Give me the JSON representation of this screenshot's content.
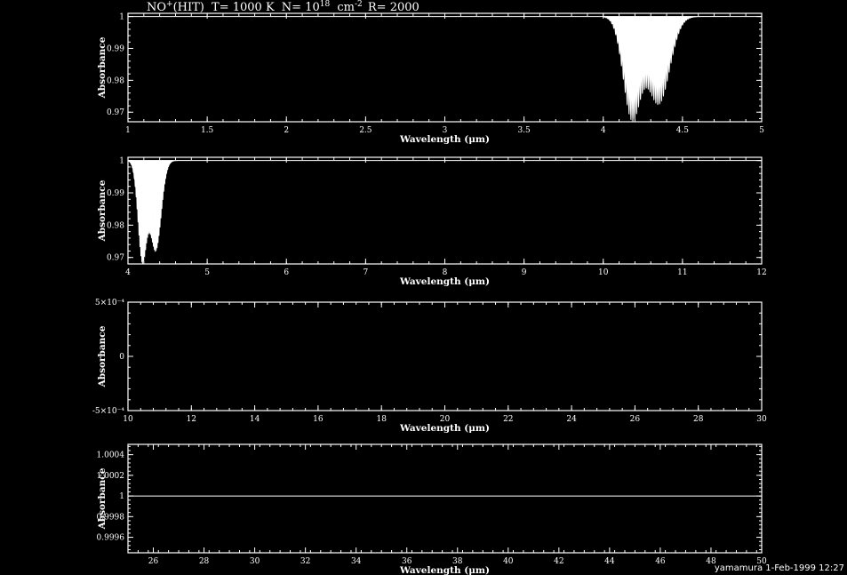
{
  "title": {
    "species": "NO",
    "species_sup": "+",
    "source": "(HIT)",
    "temperature": "T= 1000 K",
    "column_prefix": "N= 10",
    "column_exp": "18",
    "column_unit": "cm",
    "column_unit_exp": "-2",
    "resolution": "R= 2000"
  },
  "footer": "yamamura  1-Feb-1999 12:27",
  "chart_data": [
    {
      "type": "area",
      "xlabel": "Wavelength (μm)",
      "ylabel": "Absorbance",
      "xlim": [
        1,
        5
      ],
      "ylim": [
        0.967,
        1.001
      ],
      "xticks": [
        1,
        1.5,
        2,
        2.5,
        3,
        3.5,
        4,
        4.5,
        5
      ],
      "xticklabels": [
        "1",
        "1.5",
        "2",
        "2.5",
        "3",
        "3.5",
        "4",
        "4.5",
        "5"
      ],
      "yticks": [
        0.97,
        0.98,
        0.99,
        1
      ],
      "yticklabels": [
        "0.97",
        "0.98",
        "0.99",
        "1"
      ],
      "bands": [
        {
          "center": 4.18,
          "depth": 0.0315,
          "width": 0.055
        },
        {
          "center": 4.35,
          "depth": 0.0275,
          "width": 0.07
        }
      ],
      "band_range": [
        4.0,
        4.78
      ]
    },
    {
      "type": "area",
      "xlabel": "Wavelength (μm)",
      "ylabel": "Absorbance",
      "xlim": [
        4,
        12
      ],
      "ylim": [
        0.968,
        1.001
      ],
      "xticks": [
        4,
        5,
        6,
        7,
        8,
        9,
        10,
        11,
        12
      ],
      "xticklabels": [
        "4",
        "5",
        "6",
        "7",
        "8",
        "9",
        "10",
        "11",
        "12"
      ],
      "yticks": [
        0.97,
        0.98,
        0.99,
        1
      ],
      "yticklabels": [
        "0.97",
        "0.98",
        "0.99",
        "1"
      ],
      "bands": [
        {
          "center": 4.18,
          "depth": 0.0305,
          "width": 0.055
        },
        {
          "center": 4.35,
          "depth": 0.028,
          "width": 0.07
        }
      ],
      "band_range": [
        4.0,
        4.78
      ]
    },
    {
      "type": "line",
      "xlabel": "Wavelength (μm)",
      "ylabel": "Absorbance",
      "xlim": [
        10,
        30
      ],
      "ylim": [
        -0.0005,
        0.0005
      ],
      "xticks": [
        10,
        12,
        14,
        16,
        18,
        20,
        22,
        24,
        26,
        28,
        30
      ],
      "xticklabels": [
        "10",
        "12",
        "14",
        "16",
        "18",
        "20",
        "22",
        "24",
        "26",
        "28",
        "30"
      ],
      "yticks": [
        -0.0005,
        0,
        0.0005
      ],
      "yticklabels": [
        "-5×10⁻⁴",
        "0",
        "5×10⁻⁴"
      ],
      "line_value": null
    },
    {
      "type": "line",
      "xlabel": "Wavelength (μm)",
      "ylabel": "Absorbance",
      "xlim": [
        25,
        50
      ],
      "ylim": [
        0.99945,
        1.0005
      ],
      "xticks": [
        26,
        28,
        30,
        32,
        34,
        36,
        38,
        40,
        42,
        44,
        46,
        48,
        50
      ],
      "xticklabels": [
        "26",
        "28",
        "30",
        "32",
        "34",
        "36",
        "38",
        "40",
        "42",
        "44",
        "46",
        "48",
        "50"
      ],
      "yticks": [
        0.9996,
        0.9998,
        1,
        1.0002,
        1.0004
      ],
      "yticklabels": [
        "0.9996",
        "0.9998",
        "1",
        "1.0002",
        "1.0004"
      ],
      "line_value": 1
    }
  ]
}
